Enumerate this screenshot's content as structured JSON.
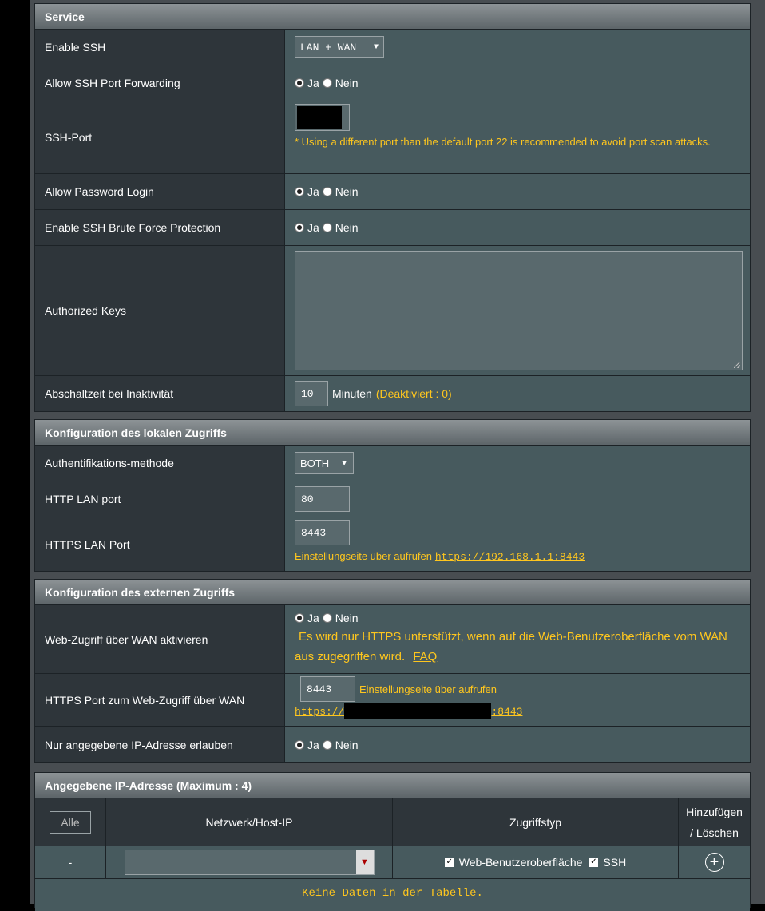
{
  "service": {
    "header": "Service",
    "enable_ssh": {
      "label": "Enable SSH",
      "value": "LAN + WAN"
    },
    "allow_ssh_port_forwarding": {
      "label": "Allow SSH Port Forwarding",
      "yes": "Ja",
      "no": "Nein"
    },
    "ssh_port": {
      "label": "SSH-Port",
      "note": "* Using a different port than the default port 22 is recommended to avoid port scan attacks."
    },
    "allow_password_login": {
      "label": "Allow Password Login",
      "yes": "Ja",
      "no": "Nein"
    },
    "brute_force": {
      "label": "Enable SSH Brute Force Protection",
      "yes": "Ja",
      "no": "Nein"
    },
    "authorized_keys": {
      "label": "Authorized Keys",
      "value": ""
    },
    "idle_timeout": {
      "label": "Abschaltzeit bei Inaktivität",
      "value": "10",
      "unit": "Minuten",
      "hint": "(Deaktiviert : 0)"
    }
  },
  "local_access": {
    "header": "Konfiguration des lokalen Zugriffs",
    "auth_method": {
      "label": "Authentifikations-methode",
      "value": "BOTH"
    },
    "http_lan_port": {
      "label": "HTTP LAN port",
      "value": "80"
    },
    "https_lan_port": {
      "label": "HTTPS LAN Port",
      "value": "8443",
      "note": "Einstellungseite über aufrufen",
      "link": "https://192.168.1.1:8443"
    }
  },
  "external_access": {
    "header": "Konfiguration des externen Zugriffs",
    "web_wan": {
      "label": "Web-Zugriff über WAN aktivieren",
      "yes": "Ja",
      "no": "Nein",
      "note": "Es wird nur HTTPS unterstützt, wenn auf die Web-Benutzeroberfläche vom WAN aus zugegriffen wird.",
      "faq": "FAQ"
    },
    "https_wan_port": {
      "label": "HTTPS Port zum Web-Zugriff über WAN",
      "value": "8443",
      "note": "Einstellungseite über aufrufen",
      "link_prefix": "https://",
      "link_suffix": ":8443"
    },
    "only_ip": {
      "label": "Nur angegebene IP-Adresse erlauben",
      "yes": "Ja",
      "no": "Nein"
    }
  },
  "ip_table": {
    "header": "Angegebene IP-Adresse (Maximum : 4)",
    "all_button": "Alle",
    "col_network": "Netzwerk/Host-IP",
    "col_access": "Zugriffstyp",
    "col_add_line1": "Hinzufügen",
    "col_add_line2": "/ Löschen",
    "row_dash": "-",
    "web_ui": "Web-Benutzeroberfläche",
    "ssh": "SSH",
    "empty": "Keine Daten in der Tabelle."
  },
  "colors": {
    "accent": "#fec61e",
    "label_bg": "#2e353a",
    "value_bg": "#475a5e"
  }
}
